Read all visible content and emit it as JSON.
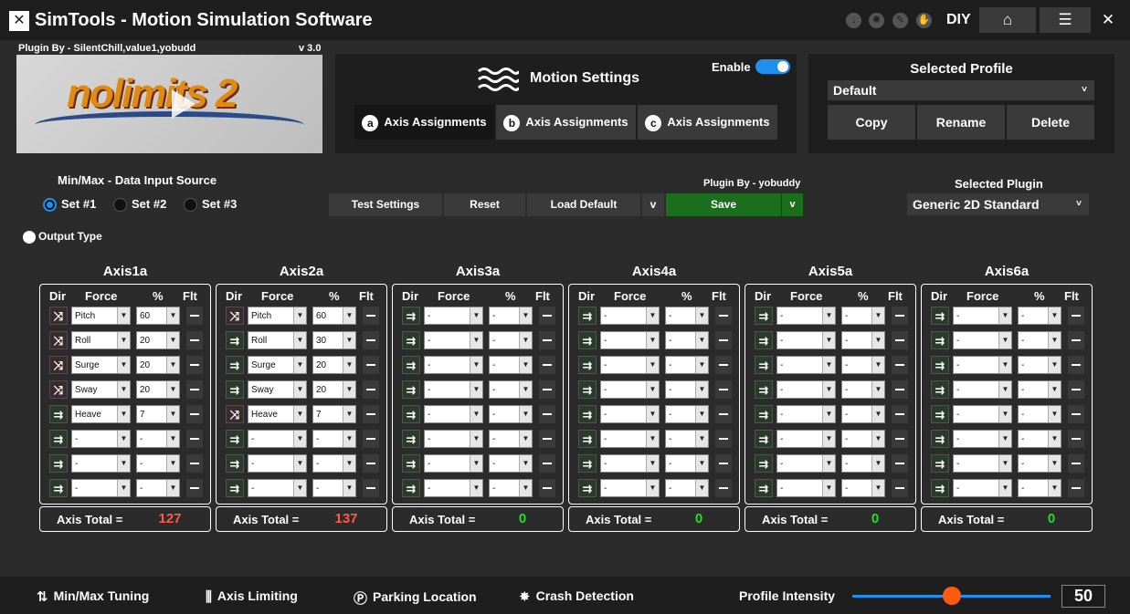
{
  "window": {
    "logo_glyph": "✕",
    "title": "SimTools - Motion Simulation Software",
    "diy_label": "DIY",
    "home_icon": "home-icon",
    "menu_icon": "menu-icon",
    "close_icon": "close-icon"
  },
  "plugin_preview": {
    "plugin_by": "Plugin By - SilentChill,value1,yobudd",
    "version": "v 3.0",
    "game_logo_text": "nolimits 2"
  },
  "motion_settings": {
    "title": "Motion Settings",
    "enable_label": "Enable",
    "enabled": true,
    "tabs": [
      {
        "letter": "a",
        "label": "Axis Assignments",
        "active": true
      },
      {
        "letter": "b",
        "label": "Axis Assignments",
        "active": false
      },
      {
        "letter": "c",
        "label": "Axis Assignments",
        "active": false
      }
    ]
  },
  "profile": {
    "title": "Selected Profile",
    "selected": "Default",
    "buttons": {
      "copy": "Copy",
      "rename": "Rename",
      "delete": "Delete"
    }
  },
  "data_input": {
    "title": "Min/Max - Data Input Source",
    "options": [
      "Set #1",
      "Set #2",
      "Set #3"
    ],
    "selected_index": 0,
    "output_type": "Output Type"
  },
  "controls": {
    "test_settings": "Test Settings",
    "reset": "Reset",
    "load_default": "Load Default",
    "dropdown_glyph": "v",
    "save": "Save",
    "plugin_by": "Plugin By - yobuddy"
  },
  "selected_plugin": {
    "title": "Selected Plugin",
    "value": "Generic 2D Standard"
  },
  "axis_headers": {
    "dir": "Dir",
    "force": "Force",
    "pct": "%",
    "flt": "Flt"
  },
  "total_label": "Axis Total =",
  "axes": [
    {
      "name": "Axis1a",
      "total": "127",
      "total_color": "#ff5a4a",
      "rows": [
        {
          "dir": "inv",
          "force": "Pitch",
          "pct": "60"
        },
        {
          "dir": "inv",
          "force": "Roll",
          "pct": "20"
        },
        {
          "dir": "inv",
          "force": "Surge",
          "pct": "20"
        },
        {
          "dir": "inv",
          "force": "Sway",
          "pct": "20"
        },
        {
          "dir": "norm",
          "force": "Heave",
          "pct": "7"
        },
        {
          "dir": "norm",
          "force": "-",
          "pct": "-"
        },
        {
          "dir": "norm",
          "force": "-",
          "pct": "-"
        },
        {
          "dir": "norm",
          "force": "-",
          "pct": "-"
        }
      ]
    },
    {
      "name": "Axis2a",
      "total": "137",
      "total_color": "#ff5a4a",
      "rows": [
        {
          "dir": "inv",
          "force": "Pitch",
          "pct": "60"
        },
        {
          "dir": "norm",
          "force": "Roll",
          "pct": "30"
        },
        {
          "dir": "norm",
          "force": "Surge",
          "pct": "20"
        },
        {
          "dir": "norm",
          "force": "Sway",
          "pct": "20"
        },
        {
          "dir": "inv",
          "force": "Heave",
          "pct": "7"
        },
        {
          "dir": "norm",
          "force": "-",
          "pct": "-"
        },
        {
          "dir": "norm",
          "force": "-",
          "pct": "-"
        },
        {
          "dir": "norm",
          "force": "-",
          "pct": "-"
        }
      ]
    },
    {
      "name": "Axis3a",
      "total": "0",
      "total_color": "#22dd22",
      "rows": [
        {
          "dir": "norm",
          "force": "-",
          "pct": "-"
        },
        {
          "dir": "norm",
          "force": "-",
          "pct": "-"
        },
        {
          "dir": "norm",
          "force": "-",
          "pct": "-"
        },
        {
          "dir": "norm",
          "force": "-",
          "pct": "-"
        },
        {
          "dir": "norm",
          "force": "-",
          "pct": "-"
        },
        {
          "dir": "norm",
          "force": "-",
          "pct": "-"
        },
        {
          "dir": "norm",
          "force": "-",
          "pct": "-"
        },
        {
          "dir": "norm",
          "force": "-",
          "pct": "-"
        }
      ]
    },
    {
      "name": "Axis4a",
      "total": "0",
      "total_color": "#22dd22",
      "rows": [
        {
          "dir": "norm",
          "force": "-",
          "pct": "-"
        },
        {
          "dir": "norm",
          "force": "-",
          "pct": "-"
        },
        {
          "dir": "norm",
          "force": "-",
          "pct": "-"
        },
        {
          "dir": "norm",
          "force": "-",
          "pct": "-"
        },
        {
          "dir": "norm",
          "force": "-",
          "pct": "-"
        },
        {
          "dir": "norm",
          "force": "-",
          "pct": "-"
        },
        {
          "dir": "norm",
          "force": "-",
          "pct": "-"
        },
        {
          "dir": "norm",
          "force": "-",
          "pct": "-"
        }
      ]
    },
    {
      "name": "Axis5a",
      "total": "0",
      "total_color": "#22dd22",
      "rows": [
        {
          "dir": "norm",
          "force": "-",
          "pct": "-"
        },
        {
          "dir": "norm",
          "force": "-",
          "pct": "-"
        },
        {
          "dir": "norm",
          "force": "-",
          "pct": "-"
        },
        {
          "dir": "norm",
          "force": "-",
          "pct": "-"
        },
        {
          "dir": "norm",
          "force": "-",
          "pct": "-"
        },
        {
          "dir": "norm",
          "force": "-",
          "pct": "-"
        },
        {
          "dir": "norm",
          "force": "-",
          "pct": "-"
        },
        {
          "dir": "norm",
          "force": "-",
          "pct": "-"
        }
      ]
    },
    {
      "name": "Axis6a",
      "total": "0",
      "total_color": "#22dd22",
      "rows": [
        {
          "dir": "norm",
          "force": "-",
          "pct": "-"
        },
        {
          "dir": "norm",
          "force": "-",
          "pct": "-"
        },
        {
          "dir": "norm",
          "force": "-",
          "pct": "-"
        },
        {
          "dir": "norm",
          "force": "-",
          "pct": "-"
        },
        {
          "dir": "norm",
          "force": "-",
          "pct": "-"
        },
        {
          "dir": "norm",
          "force": "-",
          "pct": "-"
        },
        {
          "dir": "norm",
          "force": "-",
          "pct": "-"
        },
        {
          "dir": "norm",
          "force": "-",
          "pct": "-"
        }
      ]
    }
  ],
  "bottom_bar": {
    "minmax_tuning": "Min/Max Tuning",
    "axis_limiting": "Axis Limiting",
    "parking_location": "Parking Location",
    "crash_detection": "Crash Detection",
    "profile_intensity_label": "Profile Intensity",
    "profile_intensity_value": "50",
    "intensity_fraction": 0.5
  },
  "colors": {
    "accent": "#1f8ff0",
    "save_green": "#1b6e1b",
    "slider_knob": "#ff5a10"
  }
}
